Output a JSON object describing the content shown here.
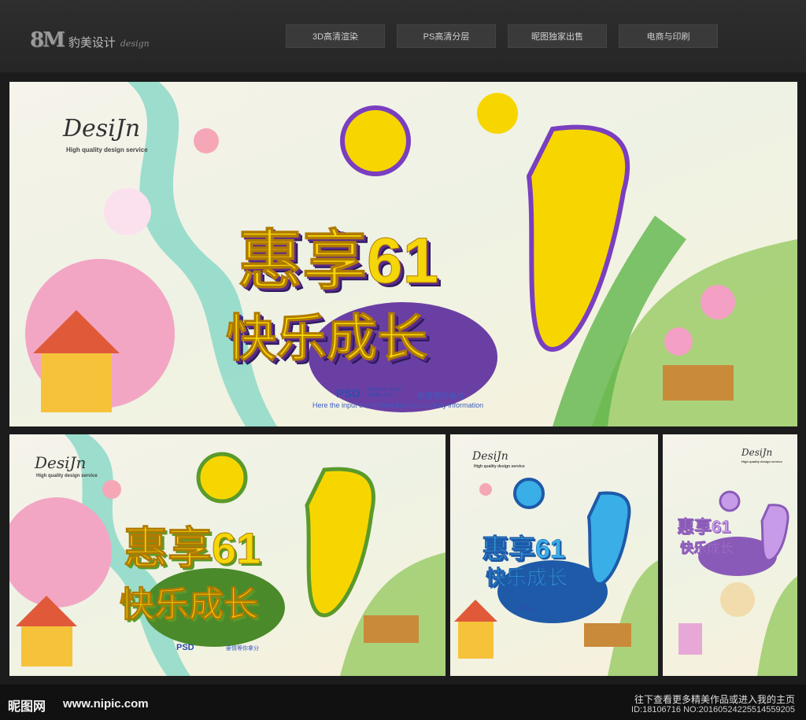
{
  "header": {
    "logo_mark": "8M",
    "logo_cn": "豹美设计",
    "logo_en": "design",
    "nav": [
      "3D高清渲染",
      "PS高清分层",
      "昵图独家出售",
      "电商与印刷"
    ]
  },
  "poster": {
    "signature": "DesiJn",
    "signature_sub": "High quality design service",
    "headline_line1": "惠享61",
    "headline_line2": "快乐成长",
    "psd": "PSD",
    "psd_tag": "DISPLAY RACK TEMPLATE",
    "slogan": "豪情等你拿分",
    "info": "Here the input event  Here the input activity information"
  },
  "colors": {
    "variant_main": "#f5d60a",
    "variant_green": "#a7d22a",
    "variant_blue": "#3aaee6",
    "variant_purple": "#c89be8"
  },
  "footer": {
    "brand": "昵图网",
    "url": "www.nipic.com",
    "line1": "往下查看更多精美作品或进入我的主页",
    "line2": "ID:18106716 NO:20160524225514559205"
  }
}
